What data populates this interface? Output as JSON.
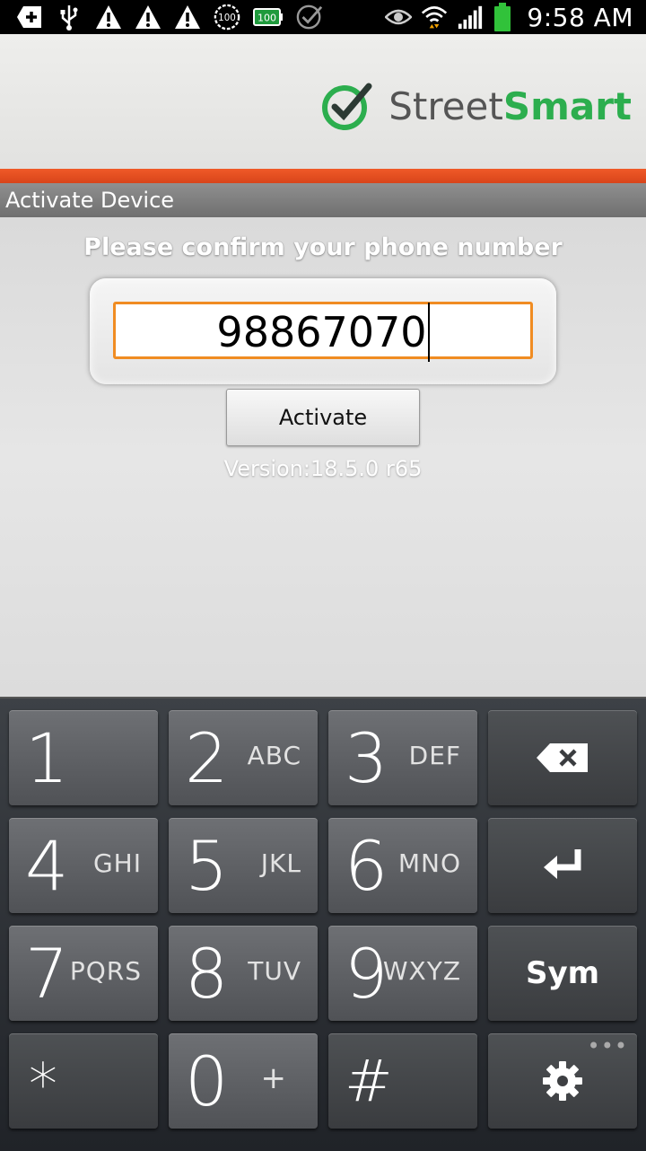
{
  "status_bar": {
    "time": "9:58 AM",
    "left_icons": [
      "add-icon",
      "usb-icon",
      "warning-icon",
      "warning-icon",
      "warning-icon",
      "badge-100-icon",
      "battery-100-icon",
      "check-circle-icon"
    ],
    "right_icons": [
      "eye-icon",
      "wifi-icon",
      "signal-icon",
      "battery-icon"
    ],
    "battery_badge": "100",
    "level_badge": "100"
  },
  "app": {
    "logo_text_street": "Street",
    "logo_text_smart": "Smart",
    "brand_colors": {
      "green": "#2cae4e",
      "orange": "#f05a28"
    }
  },
  "title_bar": {
    "title": "Activate Device"
  },
  "form": {
    "prompt": "Please confirm your phone number",
    "phone_value": "98867070",
    "activate_label": "Activate",
    "version": "Version:18.5.0 r65",
    "input_border_color": "#f08c22"
  },
  "keypad": {
    "keys": [
      {
        "digit": "1",
        "letters": ""
      },
      {
        "digit": "2",
        "letters": "ABC"
      },
      {
        "digit": "3",
        "letters": "DEF"
      },
      {
        "digit": "4",
        "letters": "GHI"
      },
      {
        "digit": "5",
        "letters": "JKL"
      },
      {
        "digit": "6",
        "letters": "MNO"
      },
      {
        "digit": "7",
        "letters": "PQRS"
      },
      {
        "digit": "8",
        "letters": "TUV"
      },
      {
        "digit": "9",
        "letters": "WXYZ"
      },
      {
        "digit": "*",
        "letters": ""
      },
      {
        "digit": "0",
        "letters": "+"
      },
      {
        "digit": "#",
        "letters": ""
      }
    ],
    "sym_label": "Sym",
    "backspace_icon": "backspace-icon",
    "enter_icon": "enter-icon",
    "settings_icon": "gear-icon",
    "more_dots": "•••"
  }
}
